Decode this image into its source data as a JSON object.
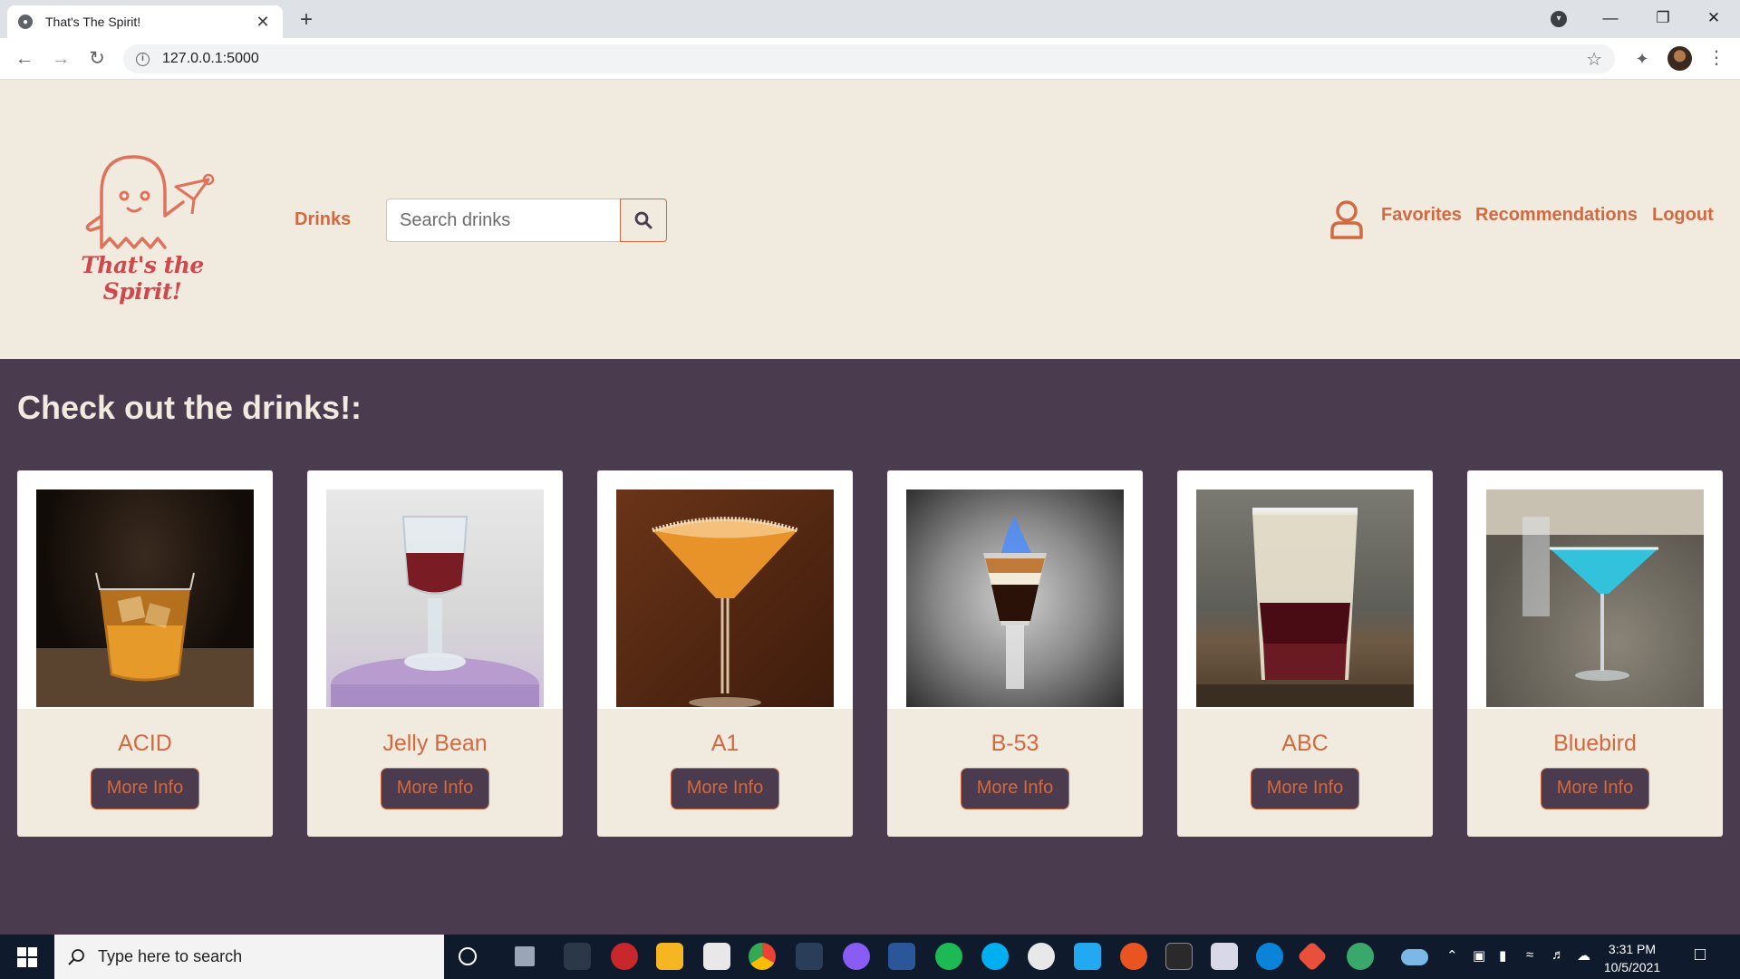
{
  "browser": {
    "tab_title": "That's The Spirit!",
    "url": "127.0.0.1:5000"
  },
  "header": {
    "logo_text": "That's the Spirit!",
    "nav_drinks": "Drinks",
    "search_placeholder": "Search drinks",
    "links": [
      "Favorites",
      "Recommendations",
      "Logout"
    ]
  },
  "main": {
    "heading": "Check out the drinks!:",
    "drinks": [
      {
        "name": "ACID",
        "button": "More Info"
      },
      {
        "name": "Jelly Bean",
        "button": "More Info"
      },
      {
        "name": "A1",
        "button": "More Info"
      },
      {
        "name": "B-53",
        "button": "More Info"
      },
      {
        "name": "ABC",
        "button": "More Info"
      },
      {
        "name": "Bluebird",
        "button": "More Info"
      }
    ]
  },
  "taskbar": {
    "search_text": "Type here to search",
    "time": "3:31 PM",
    "date": "10/5/2021"
  },
  "colors": {
    "accent": "#d4683f",
    "header_bg": "#f0eadf",
    "main_bg": "#4a3b4f"
  }
}
